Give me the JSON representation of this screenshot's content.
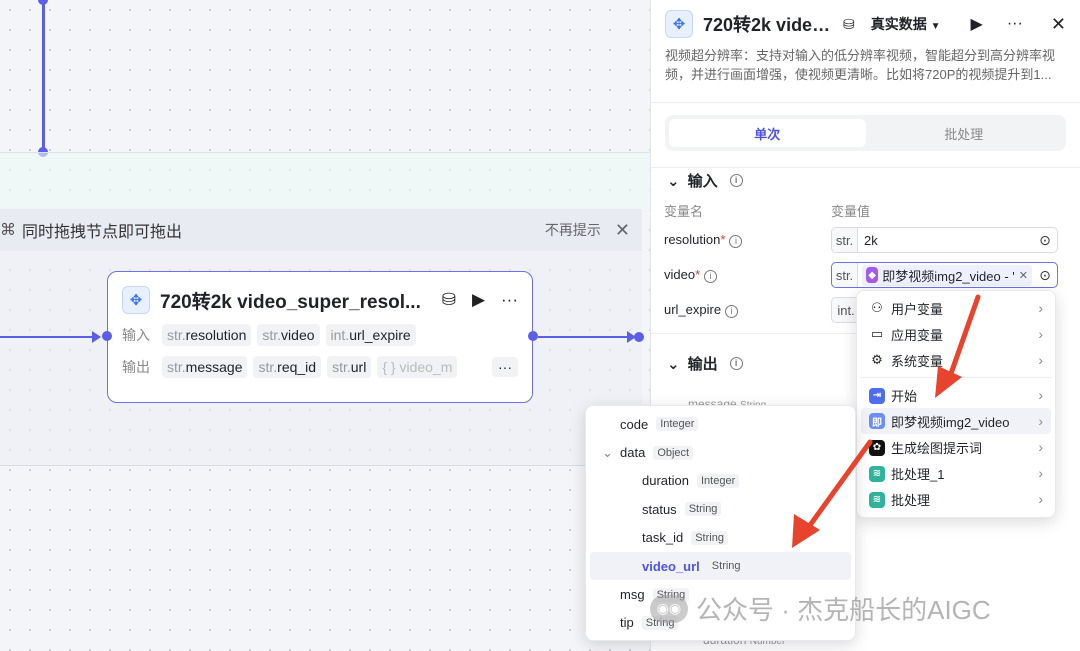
{
  "canvas": {
    "hint_text": "同时拖拽节点即可拖出",
    "hint_dismiss": "不再提示",
    "hint_close": "✕"
  },
  "node": {
    "title": "720转2k video_super_resol...",
    "input_label": "输入",
    "output_label": "输出",
    "inputs": [
      {
        "type": "str.",
        "name": "resolution"
      },
      {
        "type": "str.",
        "name": "video"
      },
      {
        "type": "int.",
        "name": "url_expire"
      }
    ],
    "outputs": [
      {
        "type": "str.",
        "name": "message"
      },
      {
        "type": "str.",
        "name": "req_id"
      },
      {
        "type": "str.",
        "name": "url"
      },
      {
        "type": "{ }",
        "name": "video_m"
      }
    ],
    "more": "···"
  },
  "panel": {
    "title": "720转2k video...",
    "data_mode": "真实数据",
    "description": "视频超分辨率：支持对输入的低分辨率视频，智能超分到高分辨率视频，并进行画面增强，使视频更清晰。比如将720P的视频提升到1...",
    "tabs": [
      "单次",
      "批处理"
    ],
    "input_section": "输入",
    "col_name": "变量名",
    "col_value": "变量值",
    "rows": [
      {
        "name": "resolution",
        "required": "*",
        "type": "str.",
        "value": "2k"
      },
      {
        "name": "video",
        "required": "*",
        "type": "str.",
        "value": "即梦视频img2_video - '"
      },
      {
        "name": "url_expire",
        "required": "",
        "type": "int.",
        "value": ""
      }
    ],
    "output_section": "输出",
    "output_peek": {
      "name": "message",
      "type": "String"
    },
    "output_peek2": {
      "name": "duration",
      "type": "Number"
    }
  },
  "menu": {
    "items": [
      {
        "icon": "user-icon",
        "label": "用户变量"
      },
      {
        "icon": "folder-icon",
        "label": "应用变量"
      },
      {
        "icon": "gear-icon",
        "label": "系统变量"
      },
      {
        "icon": "start-icon",
        "label": "开始"
      },
      {
        "icon": "video-gen-icon",
        "label": "即梦视频img2_video"
      },
      {
        "icon": "ai-draw-icon",
        "label": "生成绘图提示词"
      },
      {
        "icon": "batch-icon",
        "label": "批处理_1"
      },
      {
        "icon": "batch-icon",
        "label": "批处理"
      }
    ]
  },
  "tree": {
    "items": [
      {
        "name": "code",
        "type": "Integer",
        "level": 0
      },
      {
        "name": "data",
        "type": "Object",
        "level": 0
      },
      {
        "name": "duration",
        "type": "Integer",
        "level": 1
      },
      {
        "name": "status",
        "type": "String",
        "level": 1
      },
      {
        "name": "task_id",
        "type": "String",
        "level": 1
      },
      {
        "name": "video_url",
        "type": "String",
        "level": 1
      },
      {
        "name": "msg",
        "type": "String",
        "level": 0
      },
      {
        "name": "tip",
        "type": "String",
        "level": 0
      }
    ]
  },
  "watermark": {
    "text": "公众号 · 杰克船长的AIGC"
  },
  "colors": {
    "accent": "#4d53e8",
    "edge": "#5b5fe8",
    "arrow": "#e8432d"
  }
}
